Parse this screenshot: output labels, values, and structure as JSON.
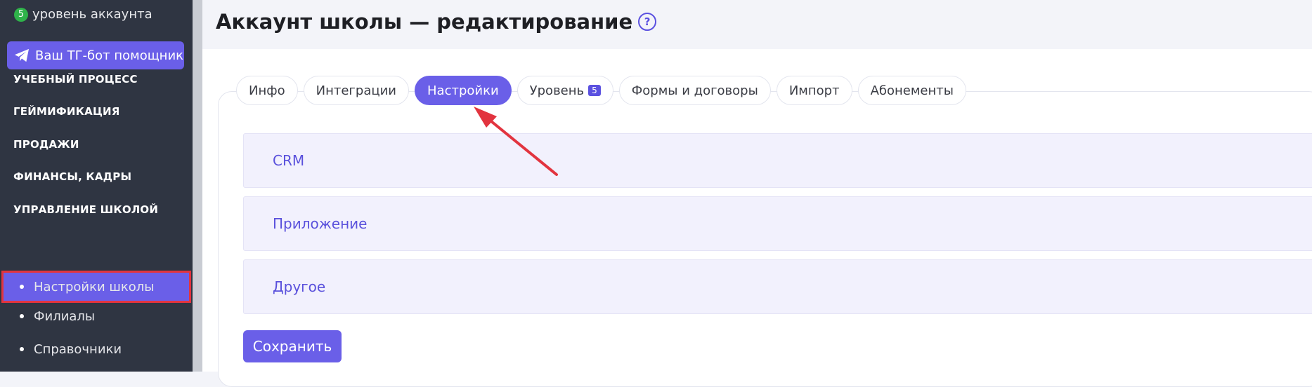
{
  "sidebar": {
    "account_level": {
      "number": "5",
      "label": "уровень аккаунта"
    },
    "tg_bot_label": "Ваш ТГ-бот помощник",
    "sections": [
      {
        "label": "УЧЕБНЫЙ ПРОЦЕСС"
      },
      {
        "label": "ГЕЙМИФИКАЦИЯ"
      },
      {
        "label": "ПРОДАЖИ"
      },
      {
        "label": "ФИНАНСЫ, КАДРЫ"
      },
      {
        "label": "УПРАВЛЕНИЕ ШКОЛОЙ"
      }
    ],
    "subitems": [
      {
        "label": "Настройки школы",
        "active": true
      },
      {
        "label": "Филиалы",
        "active": false
      },
      {
        "label": "Справочники",
        "active": false
      }
    ]
  },
  "header": {
    "title": "Аккаунт школы — редактирование",
    "help_icon": "?"
  },
  "tabs": [
    {
      "label": "Инфо"
    },
    {
      "label": "Интеграции"
    },
    {
      "label": "Настройки",
      "active": true
    },
    {
      "label": "Уровень",
      "badge": "5"
    },
    {
      "label": "Формы и договоры"
    },
    {
      "label": "Импорт"
    },
    {
      "label": "Абонементы"
    }
  ],
  "panels": [
    {
      "label": "CRM"
    },
    {
      "label": "Приложение"
    },
    {
      "label": "Другое"
    }
  ],
  "save_label": "Сохранить",
  "colors": {
    "accent": "#6a5fe8",
    "sidebar_bg": "#2f3542",
    "annotation_red": "#e2343f",
    "level_green": "#2fb34a"
  },
  "icons": [
    "telegram-icon",
    "help-icon",
    "annotation-arrow"
  ]
}
